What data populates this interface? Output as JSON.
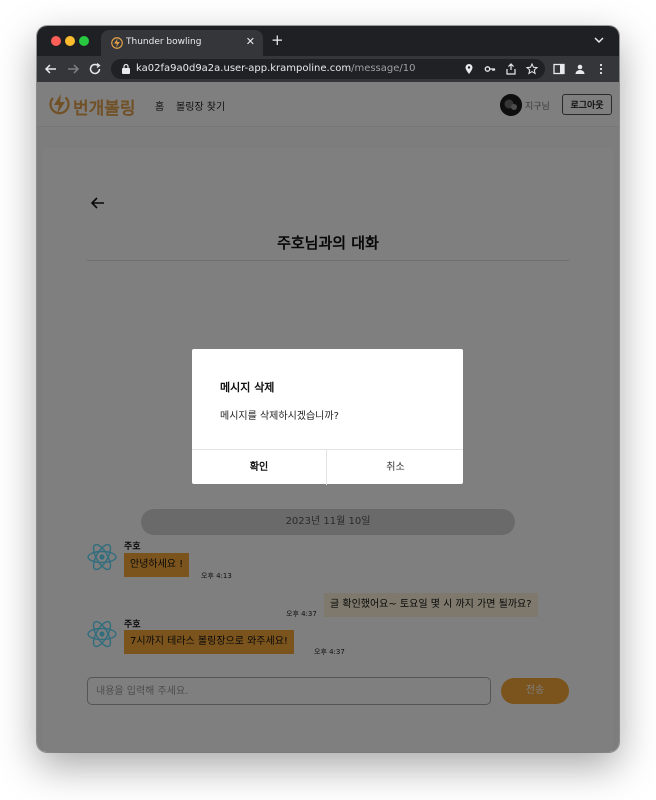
{
  "browser": {
    "tab_title": "Thunder bowling",
    "new_tab_icon": "plus-icon",
    "url_host": "ka02fa9a0d9a2a.user-app.krampoline.com",
    "url_path": "/message/10"
  },
  "header": {
    "logo_text": "번개볼링",
    "nav": {
      "home": "홈",
      "find_alley": "볼링장 찾기"
    },
    "username": "지구님",
    "logout_label": "로그아웃"
  },
  "chat": {
    "title": "주호님과의 대화",
    "date": "2023년 11월 10일",
    "messages": [
      {
        "sender": "주호",
        "text": "안녕하세요  !",
        "time": "오후 4:13",
        "mine": false
      },
      {
        "sender": "",
        "text": "글 확인했어요~ 토요일 몇 시 까지 가면 될까요?",
        "time": "오후 4:37",
        "mine": true
      },
      {
        "sender": "주호",
        "text": "7시까지 테라스 볼링장으로 와주세요!",
        "time": "오후 4:37",
        "mine": false
      }
    ],
    "input_placeholder": "내용을 입력해 주세요.",
    "send_label": "전송"
  },
  "modal": {
    "title": "메시지 삭제",
    "message": "메시지를 삭제하시겠습니까?",
    "confirm_label": "확인",
    "cancel_label": "취소"
  },
  "colors": {
    "accent": "#f7a93b",
    "logo": "#e3a14a",
    "my_bubble": "#fdf2d9",
    "react_logo": "#61dafb"
  }
}
